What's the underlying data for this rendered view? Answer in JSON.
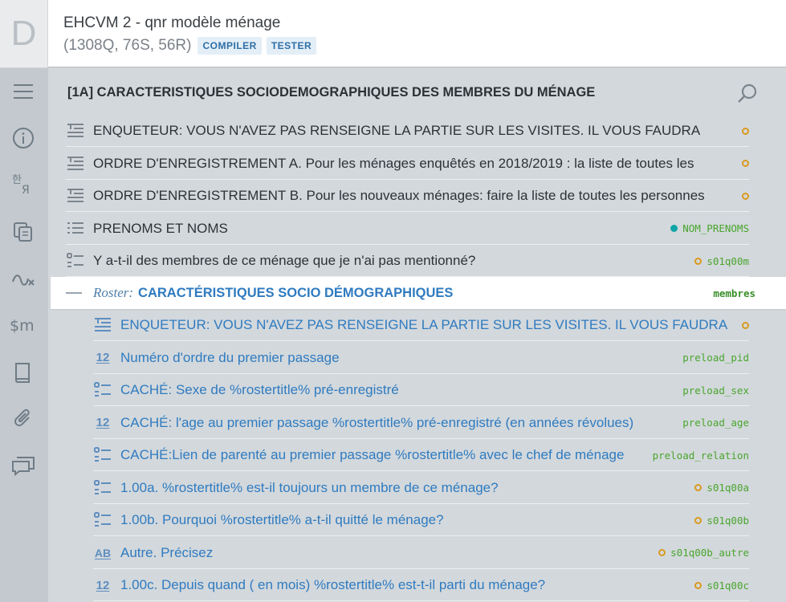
{
  "header": {
    "logo_letter": "D",
    "title": "EHCVM 2 - qnr modèle ménage",
    "stats": "(1308Q, 76S, 56R)",
    "compile_label": "COMPILER",
    "test_label": "TESTER"
  },
  "rail": {
    "icons": [
      "menu-icon",
      "info-icon",
      "translate-icon",
      "copy-icon",
      "routing-icon",
      "macros-icon",
      "book-icon",
      "attachment-icon",
      "comments-icon"
    ]
  },
  "section": {
    "title": "[1A] CARACTERISTIQUES SOCIODEMOGRAPHIQUES DES MEMBRES DU MÉNAGE"
  },
  "items": [
    {
      "icon": "static-text-icon",
      "text": "ENQUETEUR: VOUS N'AVEZ PAS RENSEIGNE LA PARTIE SUR LES VISITES. IL VOUS FAUDRA",
      "var": "",
      "status": "warning"
    },
    {
      "icon": "static-text-icon",
      "text": "ORDRE D'ENREGISTREMENT A. Pour les ménages enquêtés en 2018/2019 : la liste de toutes les",
      "var": "",
      "status": "warning"
    },
    {
      "icon": "static-text-icon",
      "text": "ORDRE D'ENREGISTREMENT B. Pour les nouveaux ménages: faire la liste de toutes les personnes",
      "var": "",
      "status": "warning"
    },
    {
      "icon": "list-question-icon",
      "text": "PRENOMS ET NOMS",
      "var": "NOM_PRENOMS",
      "status": "ok"
    },
    {
      "icon": "single-select-icon",
      "text": "Y a-t-il des membres de ce ménage que je n'ai pas mentionné?",
      "var": "s01q00m",
      "status": "warning"
    }
  ],
  "roster": {
    "label": "Roster:",
    "title": "CARACTÉRISTIQUES SOCIO DÉMOGRAPHIQUES",
    "var": "membres"
  },
  "roster_items": [
    {
      "icon": "static-text-icon",
      "text": "ENQUETEUR: VOUS N'AVEZ PAS RENSEIGNE LA PARTIE SUR LES VISITES. IL VOUS FAUDRA",
      "var": "",
      "status": "warning"
    },
    {
      "icon": "numeric-icon",
      "text": "Numéro d'ordre du premier passage",
      "var": "preload_pid",
      "status": ""
    },
    {
      "icon": "single-select-icon",
      "text": "CACHÉ: Sexe de %rostertitle% pré-enregistré",
      "var": "preload_sex",
      "status": ""
    },
    {
      "icon": "numeric-icon",
      "text": "CACHÉ: l'age au premier passage %rostertitle% pré-enregistré (en années révolues)",
      "var": "preload_age",
      "status": ""
    },
    {
      "icon": "single-select-icon",
      "text": "CACHÉ:Lien de parenté au premier passage %rostertitle% avec le chef de ménage",
      "var": "preload_relation",
      "status": ""
    },
    {
      "icon": "single-select-icon",
      "text": "1.00a. %rostertitle% est-il toujours un membre de ce ménage?",
      "var": "s01q00a",
      "status": "warning"
    },
    {
      "icon": "single-select-icon",
      "text": "1.00b. Pourquoi %rostertitle% a-t-il quitté le ménage?",
      "var": "s01q00b",
      "status": "warning"
    },
    {
      "icon": "text-icon",
      "text": "Autre. Précisez",
      "var": "s01q00b_autre",
      "status": "warning"
    },
    {
      "icon": "numeric-icon",
      "text": "1.00c. Depuis quand ( en mois) %rostertitle% est-t-il parti du ménage?",
      "var": "s01q00c",
      "status": "warning"
    }
  ],
  "icon_glyphs": {
    "numeric": "12",
    "text": "AB"
  },
  "colors": {
    "accent": "#2f7bc0",
    "variable": "#4aa52e",
    "warning": "#d99a1e",
    "ok": "#12a5a8"
  }
}
